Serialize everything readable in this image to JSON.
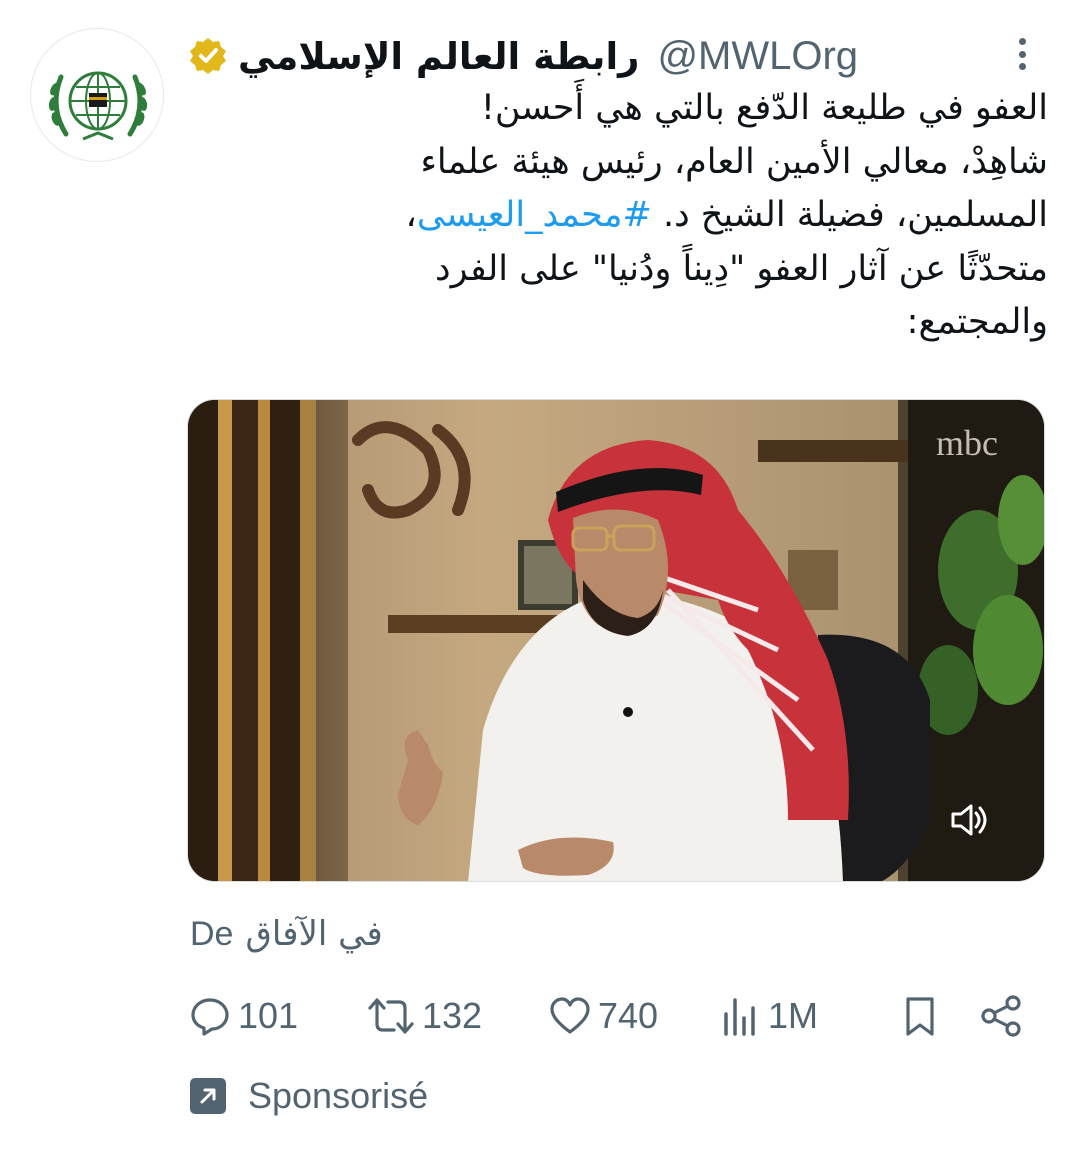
{
  "account": {
    "display_name": "رابطة العالم الإسلامي",
    "handle": "@MWLOrg",
    "verified_color": "#e2b719"
  },
  "tweet": {
    "lines": [
      "العفو في طليعة الدّفع بالتي هي أَحسن!",
      "شاهِدْ، معالي الأمين العام، رئيس هيئة علماء",
      "المسلمين، فضيلة الشيخ د.",
      "متحدّثًا عن آثار العفو \"دِيناً ودُنيا\" على الفرد",
      "والمجتمع:"
    ],
    "hashtag": "#محمد_العيسى",
    "hashtag_suffix": "،",
    "hashtag_color": "#1d9bf0"
  },
  "media": {
    "watermark": "mbc",
    "sound_icon": "speaker-icon"
  },
  "translation": {
    "prefix": "De",
    "text": "في الآفاق"
  },
  "actions": {
    "replies": "101",
    "reposts": "132",
    "likes": "740",
    "views": "1M"
  },
  "sponsored": {
    "label": "Sponsorisé"
  },
  "colors": {
    "secondary_text": "#536471",
    "primary_text": "#0f1419"
  }
}
